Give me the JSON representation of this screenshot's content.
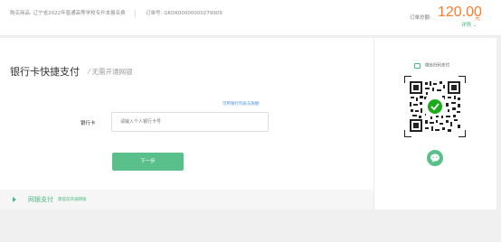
{
  "order": {
    "product_label": "购买商品:",
    "product_name": "辽宁省2022年普通高等学校专升本报名费",
    "order_no_label": "订单号:",
    "order_no": "GKDK00000000279909",
    "total_label": "订单总额:",
    "total_amount": "120.00",
    "currency_unit": "元",
    "detail_link": "详情 ⌄"
  },
  "card_pay": {
    "title": "银行卡快捷支付",
    "subtitle": "⁄ 无需开通网银",
    "supported_banks_link": "可用银行列表与限额",
    "card_label": "银行卡",
    "card_placeholder": "请输入个人银行卡号",
    "next_button": "下一步"
  },
  "net_bank": {
    "title": "网银支付",
    "subtitle": "需提前开通网银"
  },
  "scan_pay": {
    "label": "微信扫码支付",
    "icon": "wechat-icon"
  },
  "colors": {
    "accent_green": "#5ac08b",
    "amount_orange": "#fb7a2c",
    "link_blue": "#4a90e2"
  }
}
